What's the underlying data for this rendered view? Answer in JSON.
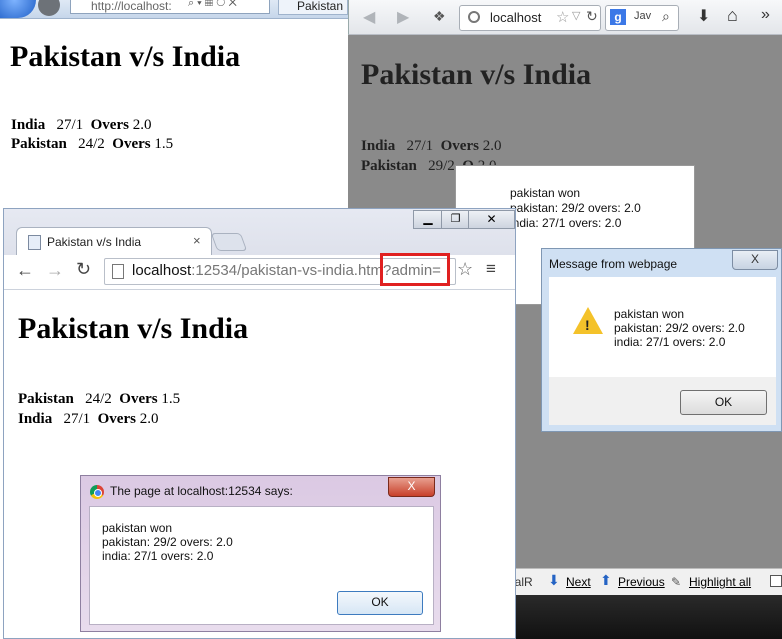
{
  "ie": {
    "address": "http://localhost:",
    "tab_label": "Pakistan",
    "page_title": "Pakistan v/s India",
    "rows": [
      {
        "team": "India",
        "score": "27/1",
        "overs_label": "Overs",
        "overs": "2.0"
      },
      {
        "team": "Pakistan",
        "score": "24/2",
        "overs_label": "Overs",
        "overs": "1.5"
      }
    ]
  },
  "firefox": {
    "url": "localhost",
    "search_engine": "g",
    "search_text": "Jav",
    "page_title": "Pakistan v/s India",
    "rows": [
      {
        "team": "India",
        "score": "27/1",
        "overs_label": "Overs",
        "overs": "2.0"
      },
      {
        "team": "Pakistan",
        "score": "29/2",
        "overs_label": "O",
        "overs": "2.0"
      }
    ],
    "popup_lines": [
      "pakistan won",
      "pakistan: 29/2 overs: 2.0",
      "india: 27/1 overs: 2.0"
    ],
    "findbar": {
      "input_value": "ealR",
      "next": "Next",
      "previous": "Previous",
      "highlight_all": "Highlight all"
    }
  },
  "ie_dialog": {
    "title": "Message from webpage",
    "close": "X",
    "lines": [
      "pakistan won",
      "pakistan: 29/2 overs: 2.0",
      "india: 27/1 overs: 2.0"
    ],
    "ok": "OK"
  },
  "chrome": {
    "tab_label": "Pakistan v/s India",
    "tab_close": "×",
    "url_host": "localhost",
    "url_rest": ":12534/pakistan-vs-india.htm?admin=",
    "page_title": "Pakistan v/s India",
    "rows": [
      {
        "team": "Pakistan",
        "score": "24/2",
        "overs_label": "Overs",
        "overs": "1.5"
      },
      {
        "team": "India",
        "score": "27/1",
        "overs_label": "Overs",
        "overs": "2.0"
      }
    ]
  },
  "chrome_alert": {
    "title": "The page at localhost:12534 says:",
    "close": "X",
    "lines": [
      "pakistan won",
      "pakistan: 29/2 overs: 2.0",
      "india: 27/1 overs: 2.0"
    ],
    "ok": "OK"
  }
}
